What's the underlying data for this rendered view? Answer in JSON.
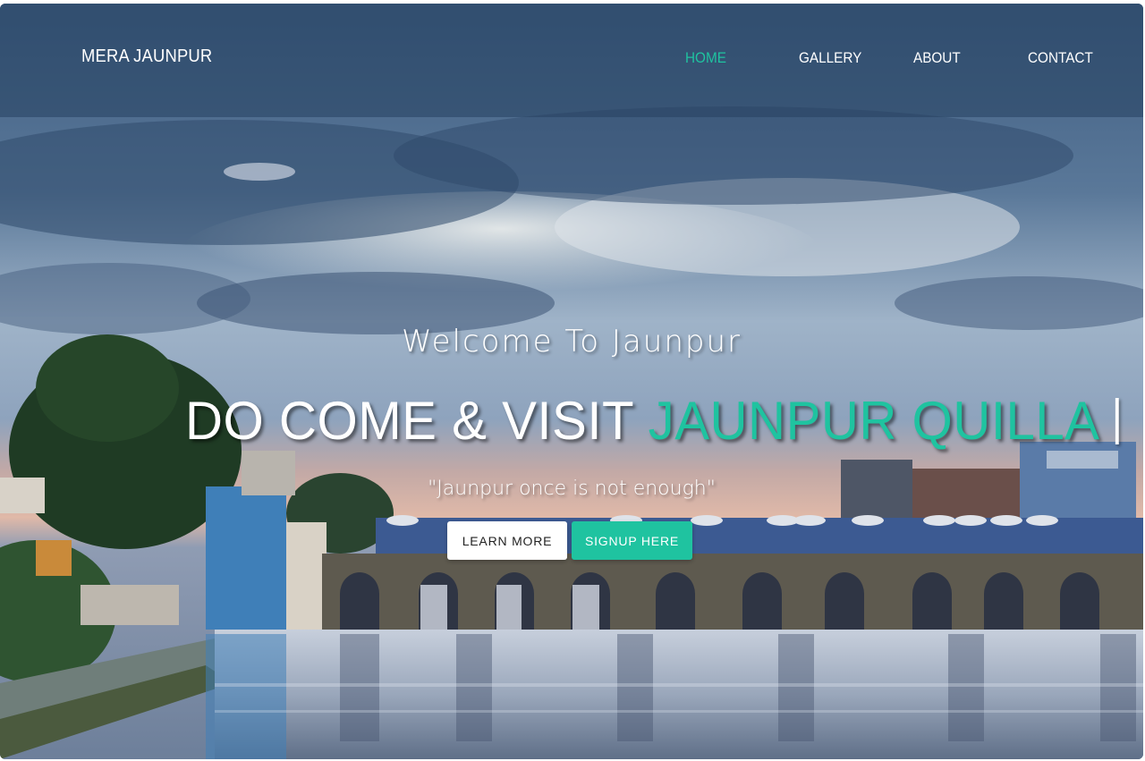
{
  "navbar": {
    "brand": "MERA JAUNPUR",
    "links": [
      {
        "label": "HOME",
        "active": true
      },
      {
        "label": "GALLERY",
        "active": false
      },
      {
        "label": "ABOUT",
        "active": false
      },
      {
        "label": "CONTACT",
        "active": false
      }
    ]
  },
  "hero": {
    "welcome": "Welcome To Jaunpur",
    "headline_prefix": "DO COME & VISIT ",
    "headline_accent": "JAUNPUR QUILLA",
    "quote": "\"Jaunpur once is not enough\"",
    "learn_more_label": "LEARN MORE",
    "signup_label": "SIGNUP HERE"
  },
  "colors": {
    "accent": "#1fc3a0",
    "navbar_overlay": "#264260",
    "button_light": "#ffffff"
  },
  "background_image": "riverside-bridge-scene"
}
